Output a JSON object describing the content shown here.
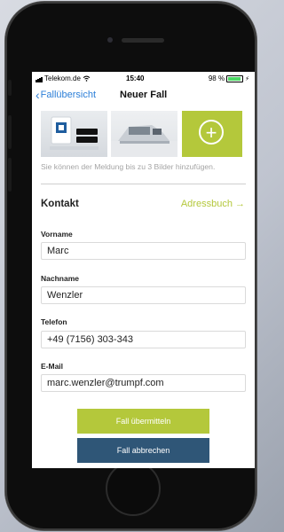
{
  "status_bar": {
    "carrier": "Telekom.de",
    "time": "15:40",
    "battery": "98 %"
  },
  "nav": {
    "back_label": "Fallübersicht",
    "title": "Neuer Fall"
  },
  "photos": {
    "hint": "Sie können der Meldung bis zu 3 Bilder hinzufügen.",
    "add_icon": "plus-circle-icon"
  },
  "contact": {
    "section_title": "Kontakt",
    "address_book": "Adressbuch →",
    "fields": [
      {
        "label": "Vorname",
        "value": "Marc"
      },
      {
        "label": "Nachname",
        "value": "Wenzler"
      },
      {
        "label": "Telefon",
        "value": "+49 (7156) 303-343"
      },
      {
        "label": "E-Mail",
        "value": "marc.wenzler@trumpf.com"
      }
    ]
  },
  "actions": {
    "submit": "Fall übermitteln",
    "cancel": "Fall abbrechen"
  },
  "colors": {
    "accent_green": "#b4c83b",
    "dark_blue": "#2f5677",
    "link_blue": "#2c7fd8"
  }
}
